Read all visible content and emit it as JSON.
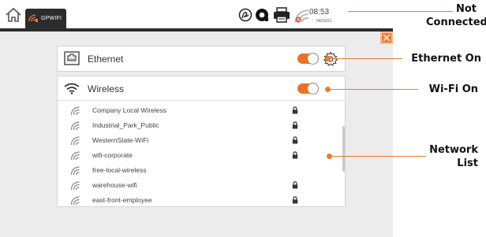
{
  "topbar": {
    "tab_label": "GPWIFI",
    "clock": "08:53",
    "date": "04/23/21"
  },
  "ethernet": {
    "label": "Ethernet",
    "enabled": true
  },
  "wireless": {
    "label": "Wireless",
    "enabled": true,
    "networks": [
      {
        "name": "Company Local Wireless",
        "locked": true
      },
      {
        "name": "Industrial_Park_Public",
        "locked": true
      },
      {
        "name": "WesternState-WiFi",
        "locked": true
      },
      {
        "name": "wifi-corporate",
        "locked": true
      },
      {
        "name": "free-local-wireless",
        "locked": false
      },
      {
        "name": "warehouse-wifi",
        "locked": true
      },
      {
        "name": "east-front-employee",
        "locked": true
      }
    ]
  },
  "callouts": {
    "not_connected_line1": "Not",
    "not_connected_line2": "Connected",
    "ethernet_on": "Ethernet On",
    "wifi_on": "Wi-Fi On",
    "network_list_line1": "Network",
    "network_list_line2": "List"
  },
  "colors": {
    "accent": "#ef7020",
    "dark_bar": "#2c2c2c",
    "background": "#ececec"
  },
  "icons": [
    "home-icon",
    "wifi-icon",
    "printer-icon",
    "camera-icon",
    "signal-icon",
    "settings-gear-icon",
    "close-icon",
    "lock-icon",
    "ethernet-port-icon"
  ]
}
